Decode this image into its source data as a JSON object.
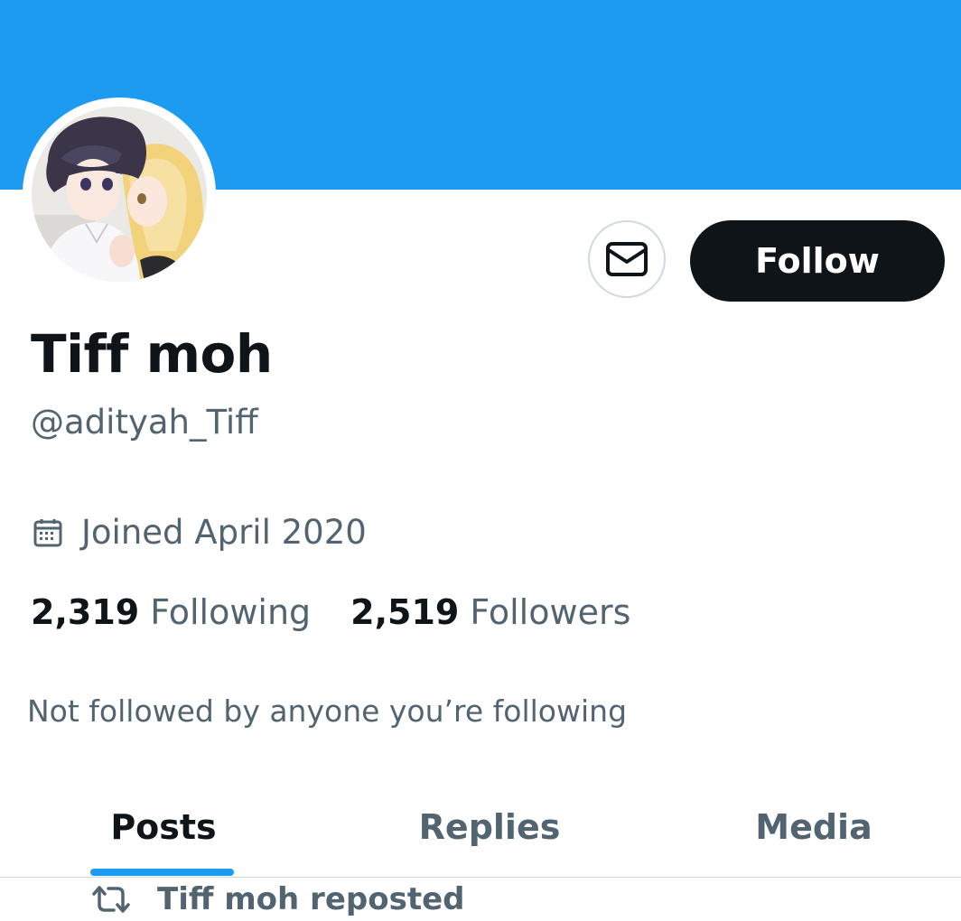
{
  "colors": {
    "banner": "#1d9bf0",
    "primary_text": "#0f1419",
    "secondary_text": "#536471",
    "accent": "#1d9bf0",
    "border": "#cfd9de"
  },
  "header": {
    "banner_icon": "profile-banner",
    "avatar_icon": "anime-avatar"
  },
  "actions": {
    "message_icon": "envelope-icon",
    "follow_label": "Follow"
  },
  "profile": {
    "display_name": "Tiff moh",
    "handle": "@adityah_Tiff",
    "joined_icon": "calendar-icon",
    "joined": "Joined April 2020",
    "following_count": "2,319",
    "following_label": "Following",
    "followers_count": "2,519",
    "followers_label": "Followers",
    "mutuals_note": "Not followed by anyone you’re following"
  },
  "tabs": [
    {
      "label": "Posts",
      "active": true
    },
    {
      "label": "Replies",
      "active": false
    },
    {
      "label": "Media",
      "active": false
    }
  ],
  "feed": {
    "repost_icon": "repost-icon",
    "repost_label": "Tiff moh reposted"
  }
}
